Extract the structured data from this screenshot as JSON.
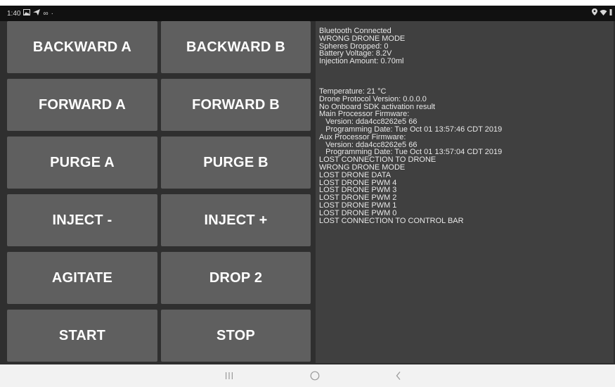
{
  "statusbar": {
    "time": "1:40",
    "icons_left": [
      "gallery-icon",
      "send-icon",
      "infinity-icon",
      "dot-icon"
    ],
    "icons_right": [
      "location-icon",
      "wifi-icon",
      "battery-icon"
    ]
  },
  "buttons": [
    {
      "label": "BACKWARD A"
    },
    {
      "label": "BACKWARD B"
    },
    {
      "label": "FORWARD A"
    },
    {
      "label": "FORWARD B"
    },
    {
      "label": "PURGE A"
    },
    {
      "label": "PURGE B"
    },
    {
      "label": "INJECT -"
    },
    {
      "label": "INJECT +"
    },
    {
      "label": "AGITATE"
    },
    {
      "label": "DROP 2"
    },
    {
      "label": "START"
    },
    {
      "label": "STOP"
    }
  ],
  "status_panel": {
    "summary": [
      "Bluetooth Connected",
      "WRONG DRONE MODE",
      "Spheres Dropped: 0",
      "Battery Voltage: 8.2V",
      "Injection Amount: 0.70ml"
    ],
    "log": [
      "Temperature: 21 °C",
      "Drone Protocol Version: 0.0.0.0",
      "No Onboard SDK activation result",
      "Main Processor Firmware:",
      "   Version: dda4cc8262e5 66",
      "   Programming Date: Tue Oct 01 13:57:46 CDT 2019",
      "Aux Processor Firmware:",
      "   Version: dda4cc8262e5 66",
      "   Programming Date: Tue Oct 01 13:57:04 CDT 2019",
      "LOST CONNECTION TO DRONE",
      "WRONG DRONE MODE",
      "LOST DRONE DATA",
      "LOST DRONE PWM 4",
      "LOST DRONE PWM 3",
      "LOST DRONE PWM 2",
      "LOST DRONE PWM 1",
      "LOST DRONE PWM 0",
      "LOST CONNECTION TO CONTROL BAR"
    ]
  },
  "navbar": {
    "items": [
      "recent-apps-icon",
      "home-icon",
      "back-icon"
    ],
    "glyphs": [
      "|||",
      "○",
      "‹"
    ]
  }
}
